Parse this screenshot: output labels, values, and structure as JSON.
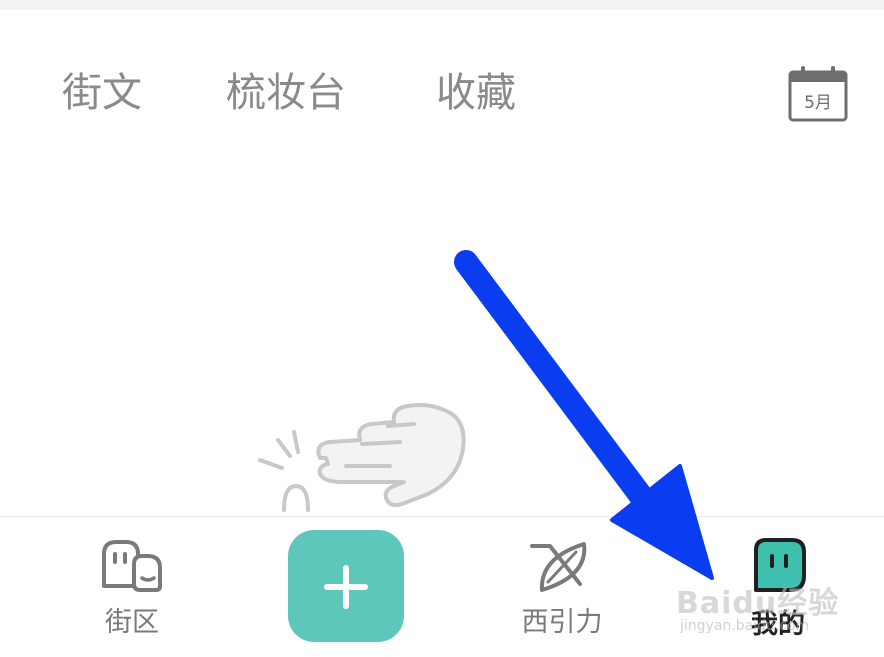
{
  "top_tabs": {
    "items": [
      {
        "label": "街文"
      },
      {
        "label": "梳妆台"
      },
      {
        "label": "收藏"
      }
    ]
  },
  "calendar": {
    "label": "5月",
    "icon": "calendar-icon"
  },
  "bottom_nav": {
    "items": [
      {
        "label": "街区",
        "icon": "street-district-icon"
      },
      {
        "label": "",
        "icon": "plus-icon"
      },
      {
        "label": "西引力",
        "icon": "leaf-icon"
      },
      {
        "label": "我的",
        "icon": "profile-face-icon",
        "active": true
      }
    ]
  },
  "colors": {
    "accent": "#5ec7bc",
    "tab_text": "#8a8a8a",
    "arrow": "#0a3cf0",
    "profile_icon": "#3fbfae"
  },
  "watermark": {
    "text": "Baidu经验",
    "sub": "jingyan.baidu.com"
  }
}
